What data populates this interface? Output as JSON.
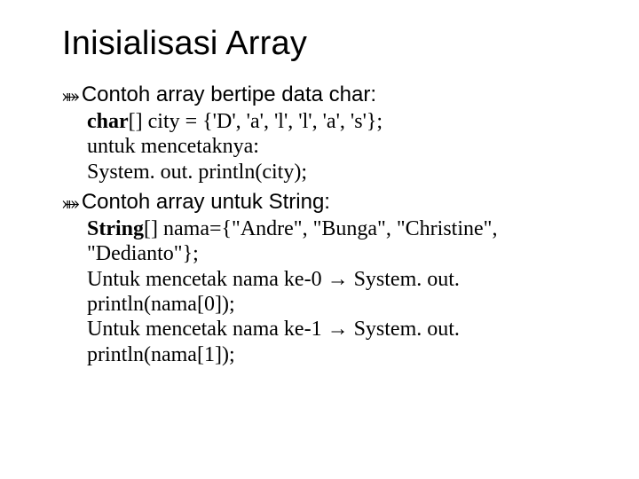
{
  "title": "Inisialisasi Array",
  "bullet1": "Contoh array bertipe data char:",
  "line1a_bold": "char",
  "line1a_rest": "[] city = {'D', 'a', 'l', 'l', 'a', 's'};",
  "line1b": "untuk mencetaknya:",
  "line1c": "System. out. println(city);",
  "bullet2": "Contoh array untuk String:",
  "line2a_bold": "String",
  "line2a_rest": "[] nama={\"Andre\", \"Bunga\", \"Christine\", \"Dedianto\"};",
  "line2b": "Untuk mencetak nama ke-0 → System. out. println(nama[0]);",
  "line2c": "Untuk mencetak nama ke-1 → System. out. println(nama[1]);"
}
